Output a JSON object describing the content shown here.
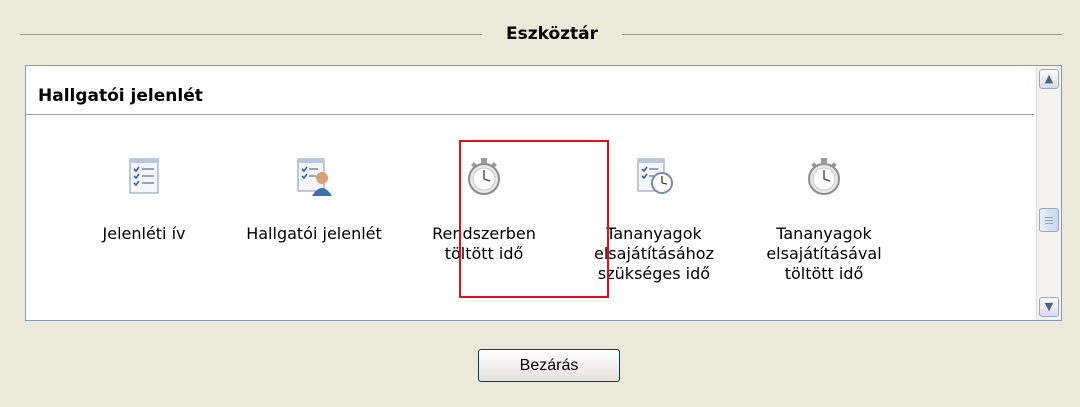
{
  "toolbar": {
    "title": "Eszköztár"
  },
  "panel": {
    "section_title": "Hallgatói jelenlét",
    "items": [
      {
        "label": "Jelenléti ív",
        "icon": "checklist-icon"
      },
      {
        "label": "Hallgatói jelenlét",
        "icon": "checklist-user-icon"
      },
      {
        "label": "Rendszerben\ntöltött idő",
        "icon": "stopwatch-icon",
        "highlighted": true
      },
      {
        "label": "Tananyagok\nelsajátításához\nszükséges idő",
        "icon": "checklist-clock-icon"
      },
      {
        "label": "Tananyagok\nelsajátításával\ntöltött idő",
        "icon": "stopwatch-icon"
      }
    ]
  },
  "colors": {
    "highlight": "#e0101a",
    "background": "#ece9d8"
  },
  "footer": {
    "close_label": "Bezárás"
  }
}
